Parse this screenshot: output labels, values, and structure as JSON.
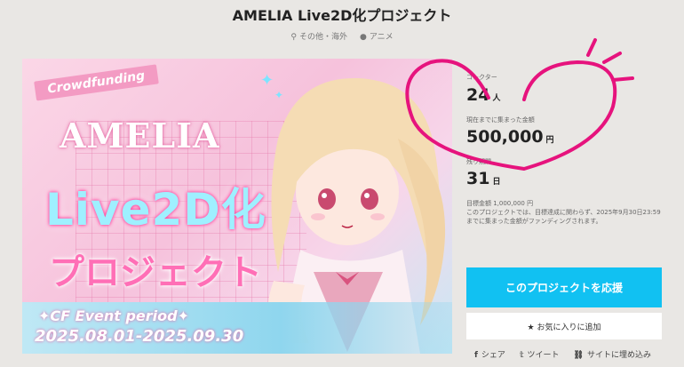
{
  "page": {
    "title": "AMELIA Live2D化プロジェクト",
    "location": "その他・海外",
    "category": "アニメ"
  },
  "hero": {
    "tag": "Crowdfunding",
    "heading1": "AMELIA",
    "heading2": "Live2D化",
    "heading3": "プロジェクト",
    "event": "✦CF Event period✦",
    "dates": "2025.08.01-2025.09.30"
  },
  "stats": {
    "collectors_label": "コレクター",
    "collectors_value": "24",
    "collectors_unit": "人",
    "raised_label": "現在までに集まった金額",
    "raised_value": "500,000",
    "raised_unit": "円",
    "remaining_label": "残り期間",
    "remaining_value": "31",
    "remaining_unit": "日",
    "goal": "目標金額 1,000,000 円",
    "note": "このプロジェクトでは、目標達成に関わらず、2025年9月30日23:59までに集まった金額がファンディングされます。"
  },
  "actions": {
    "support": "このプロジェクトを応援",
    "favorite": "お気に入りに追加",
    "share": "シェア",
    "tweet": "ツイート",
    "embed": "サイトに埋め込み"
  },
  "colors": {
    "accent": "#11c1f2",
    "annotation": "#e6137d"
  }
}
